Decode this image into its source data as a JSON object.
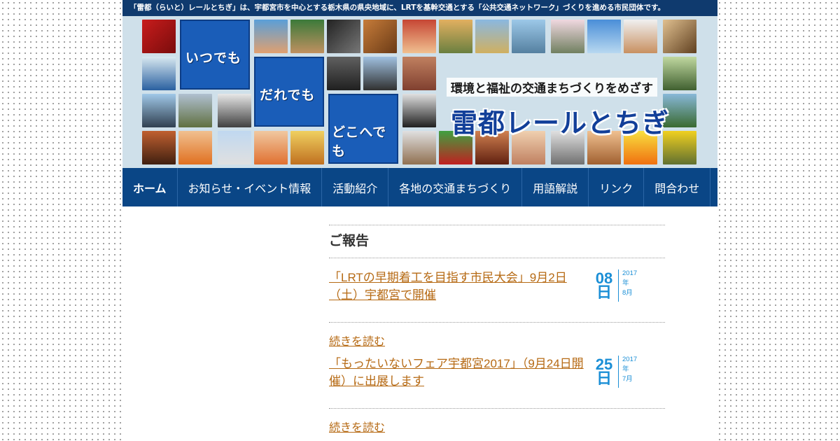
{
  "topbar": {
    "text": "「雷都（らいと）レールとちぎ」は、宇都宮市を中心とする栃木県の県央地域に、LRTを基幹交通とする「公共交通ネットワーク」づくりを進める市民団体です。"
  },
  "banner": {
    "slogans": [
      "いつでも",
      "だれでも",
      "どこへでも"
    ],
    "tagline": "環境と福祉の交通まちづくりをめざす",
    "brand": "雷都レールとちぎ"
  },
  "nav": {
    "items": [
      "ホーム",
      "お知らせ・イベント情報",
      "活動紹介",
      "各地の交通まちづくり",
      "用語解説",
      "リンク",
      "問合わせ"
    ]
  },
  "section": {
    "title": "ご報告"
  },
  "posts": [
    {
      "title": "「LRTの早期着工を目指す市民大会」9月2日（土）宇都宮で開催",
      "day": "08",
      "day_suffix": "日",
      "year": "2017",
      "year_suffix": "年",
      "month": "8月",
      "readmore": "続きを読む"
    },
    {
      "title": "「もったいないフェア宇都宮2017」（9月24日開催）に出展します",
      "day": "25",
      "day_suffix": "日",
      "year": "2017",
      "year_suffix": "年",
      "month": "7月",
      "readmore": "続きを読む"
    }
  ]
}
